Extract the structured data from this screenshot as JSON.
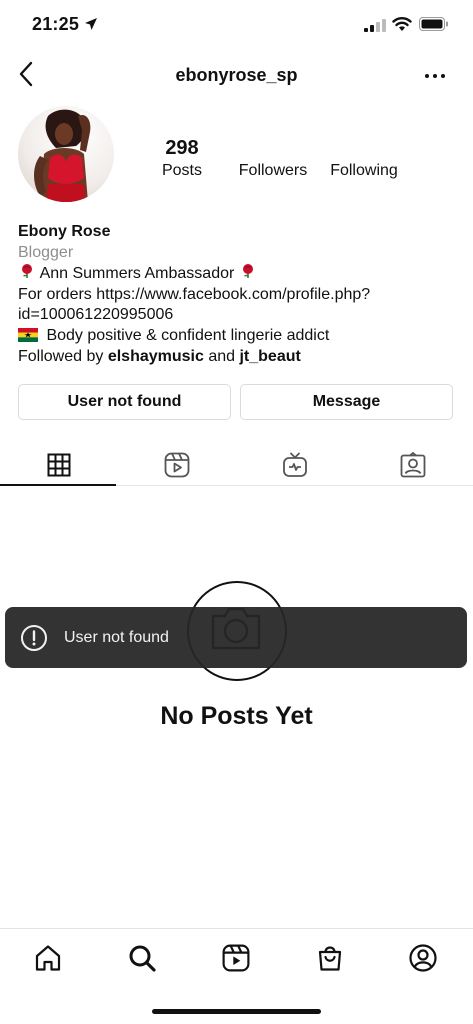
{
  "status_bar": {
    "time": "21:25",
    "icons": [
      "location-arrow-icon",
      "signal-icon",
      "wifi-icon",
      "battery-icon"
    ]
  },
  "header": {
    "username": "ebonyrose_sp",
    "back_icon": "chevron-left-icon",
    "more_icon": "more-horizontal-icon"
  },
  "profile": {
    "stats": {
      "posts_count": "298",
      "posts_label": "Posts",
      "followers_label": "Followers",
      "following_label": "Following"
    },
    "name": "Ebony Rose",
    "category": "Blogger",
    "bio_line1": "Ann Summers Ambassador",
    "bio_line2": "For orders https://www.facebook.com/profile.php?",
    "bio_line3": "id=100061220995006",
    "bio_line4": "Body positive & confident lingerie addict",
    "followed_by_prefix": "Followed by ",
    "followed_by_user1": "elshaymusic",
    "followed_by_and": " and ",
    "followed_by_user2": "jt_beaut"
  },
  "buttons": {
    "follow_label": "User not found",
    "message_label": "Message"
  },
  "tabs": [
    "grid-icon",
    "reels-icon",
    "igtv-icon",
    "tagged-icon"
  ],
  "empty_state": {
    "title": "No Posts Yet"
  },
  "toast": {
    "text": "User not found",
    "icon": "alert-circle-icon"
  },
  "bottom_nav": [
    "home-icon",
    "search-icon",
    "reels-icon",
    "shop-icon",
    "profile-icon"
  ],
  "colors": {
    "text": "#111111",
    "muted": "#8e8e8e",
    "border": "#dbdbdb",
    "toast_bg": "#262626",
    "rose": "#c8102e"
  }
}
